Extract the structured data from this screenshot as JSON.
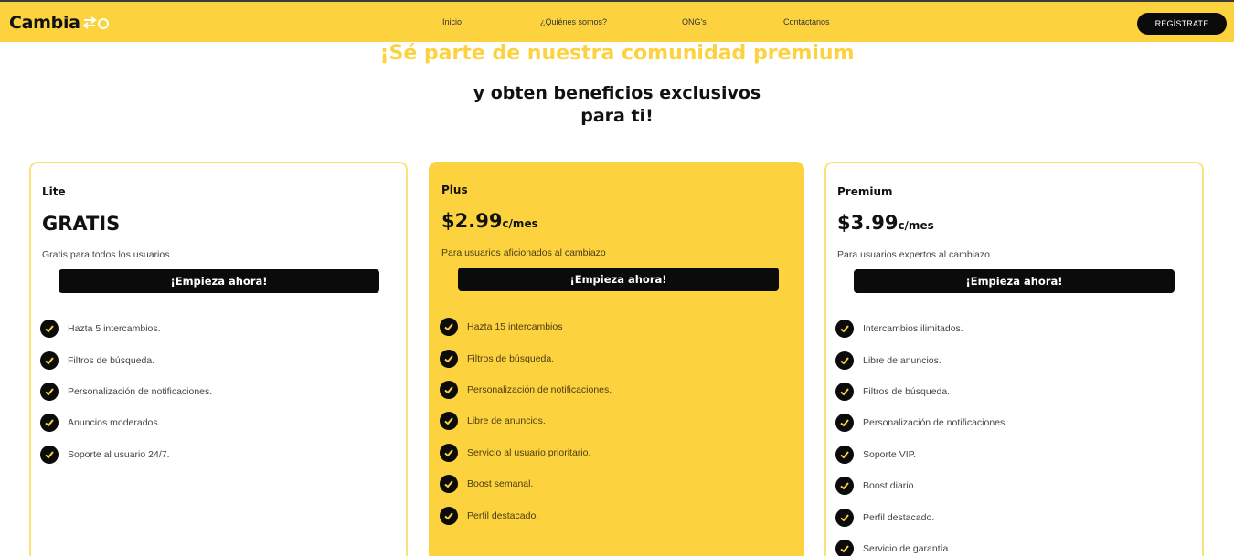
{
  "brand": {
    "name": "Cambia",
    "accent_color": "#fdd23f",
    "dark_color": "#0b0b0b",
    "logo_icon": "swap-arrows-icon"
  },
  "nav": {
    "items": [
      {
        "label": "Inicio"
      },
      {
        "label": "¿Quiénes somos?"
      },
      {
        "label": "ONG's"
      },
      {
        "label": "Contáctanos"
      }
    ],
    "register_label": "REGÍSTRATE"
  },
  "hero": {
    "headline": "¡Sé parte de nuestra comunidad premium",
    "subline_1": "y obten beneficios exclusivos",
    "subline_2": "para ti!"
  },
  "plans": [
    {
      "name": "Lite",
      "price": "GRATIS",
      "price_unit": "",
      "description": "Gratis para todos los usuarios",
      "cta": "¡Empieza ahora!",
      "features": [
        "Hazta 5 intercambios.",
        "Filtros de búsqueda.",
        "Personalización de notificaciones.",
        "Anuncios moderados.",
        "Soporte al usuario 24/7."
      ]
    },
    {
      "name": "Plus",
      "price": "$2.99",
      "price_unit": "c/mes",
      "description": "Para usuarios aficionados al cambiazo",
      "cta": "¡Empieza ahora!",
      "features": [
        "Hazta 15 intercambios",
        "Filtros de búsqueda.",
        "Personalización de notificaciones.",
        "Libre de anuncios.",
        "Servicio al usuario prioritario.",
        "Boost semanal.",
        "Perfil destacado."
      ]
    },
    {
      "name": "Premium",
      "price": "$3.99",
      "price_unit": "c/mes",
      "description": "Para usuarios expertos al cambiazo",
      "cta": "¡Empieza ahora!",
      "features": [
        "Intercambios ilimitados.",
        "Libre de anuncios.",
        "Filtros de búsqueda.",
        "Personalización de notificaciones.",
        "Soporte VIP.",
        "Boost diario.",
        "Perfil destacado.",
        "Servicio de garantía."
      ]
    }
  ]
}
